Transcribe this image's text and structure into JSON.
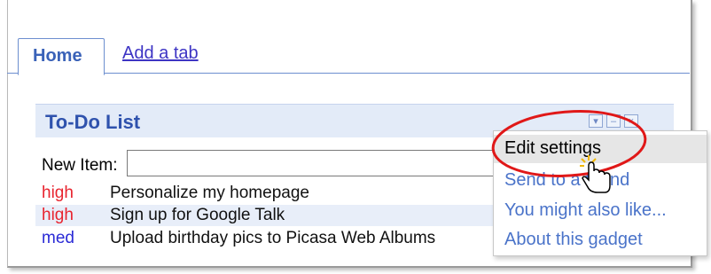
{
  "tabs": {
    "home_label": "Home",
    "add_tab_label": "Add a tab"
  },
  "gadget": {
    "title": "To-Do List",
    "buttons": [
      {
        "icon": "dropdown-icon"
      },
      {
        "icon": "minimize-icon"
      },
      {
        "icon": "close-icon"
      }
    ],
    "new_item_label": "New Item:",
    "new_item_value": "",
    "items": [
      {
        "priority": "high",
        "task": "Personalize my homepage"
      },
      {
        "priority": "high",
        "task": "Sign up for Google Talk"
      },
      {
        "priority": "med",
        "task": "Upload birthday pics to Picasa Web Albums"
      }
    ]
  },
  "menu": {
    "items": [
      {
        "label": "Edit settings"
      },
      {
        "label": "Send to a friend"
      },
      {
        "label": "You might also like..."
      },
      {
        "label": "About this gadget"
      }
    ]
  },
  "colors": {
    "high": "#e8242f",
    "med": "#2b2bd6",
    "accent": "#2f52ad",
    "annotation": "#e01818"
  }
}
